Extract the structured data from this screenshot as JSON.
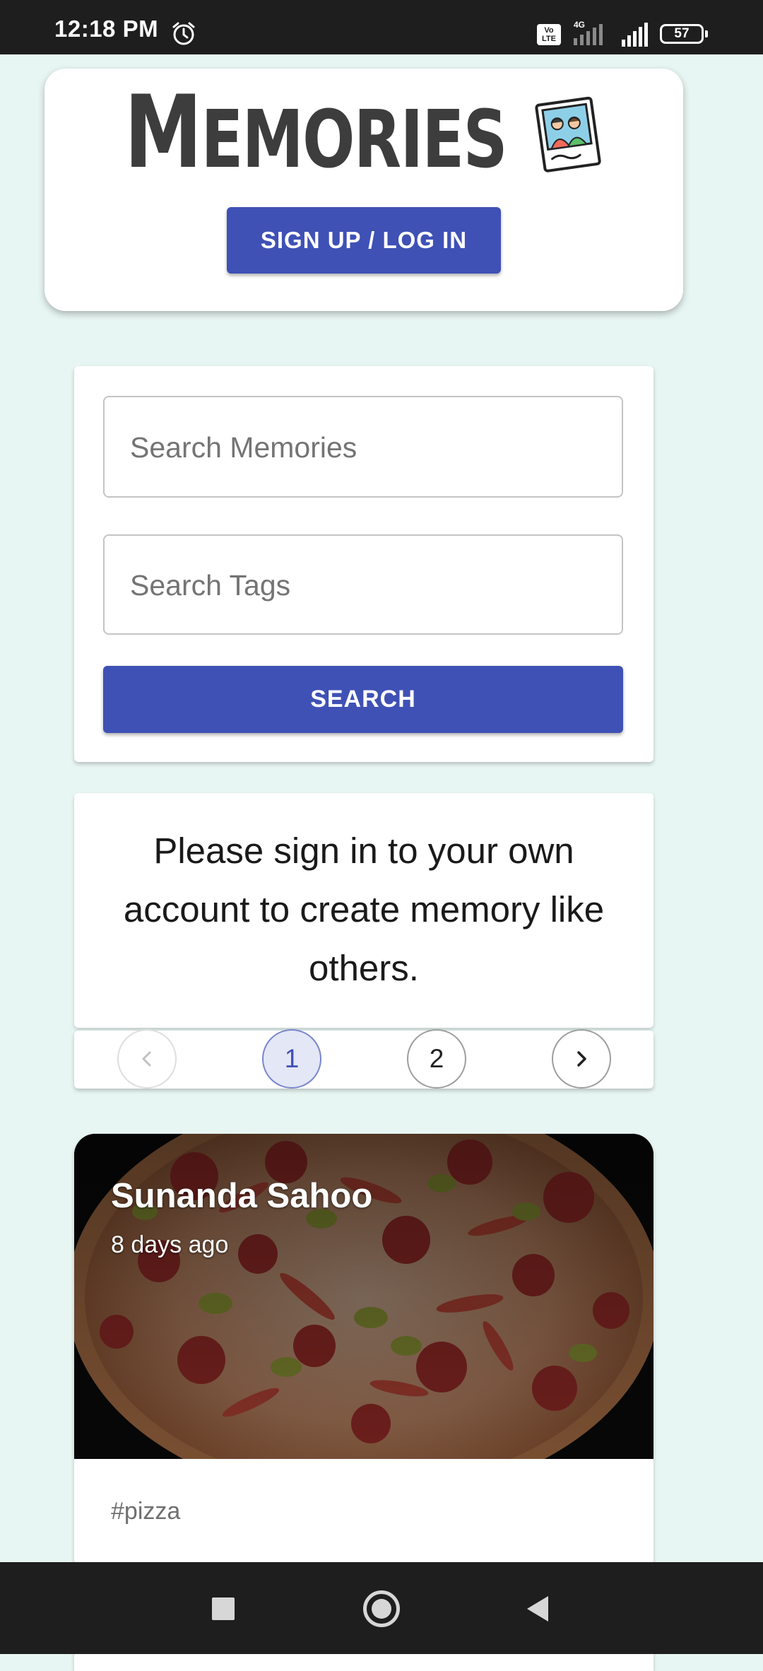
{
  "status_bar": {
    "time": "12:18 PM",
    "volte_label": "Vo LTE",
    "network_label": "4G",
    "battery_level": "57",
    "icons": [
      "alarm-icon",
      "volte-icon",
      "signal-4g-icon",
      "signal-icon",
      "battery-icon"
    ]
  },
  "header": {
    "title_initial": "M",
    "title_rest": "EMORIES",
    "logo_icon": "memories-photo-logo",
    "auth_button_label": "SIGN UP / LOG IN"
  },
  "search": {
    "memories_placeholder": "Search Memories",
    "memories_value": "",
    "tags_placeholder": "Search Tags",
    "tags_value": "",
    "button_label": "SEARCH"
  },
  "info": {
    "message": "Please sign in to your own account to create memory like others."
  },
  "pagination": {
    "prev_icon": "chevron-left-icon",
    "pages": [
      "1",
      "2"
    ],
    "current_page": "1",
    "next_icon": "chevron-right-icon"
  },
  "posts": [
    {
      "author": "Sunanda Sahoo",
      "time_ago": "8 days ago",
      "tags": "#pizza",
      "image": "pizza-photo"
    }
  ],
  "nav_bar": {
    "icons": [
      "recents-square-icon",
      "home-circle-icon",
      "back-triangle-icon"
    ]
  },
  "colors": {
    "primary": "#3f51b5",
    "page_background": "#e8f6f3",
    "status_bar": "#1e1e1e",
    "title_text": "#3d3d3d"
  }
}
